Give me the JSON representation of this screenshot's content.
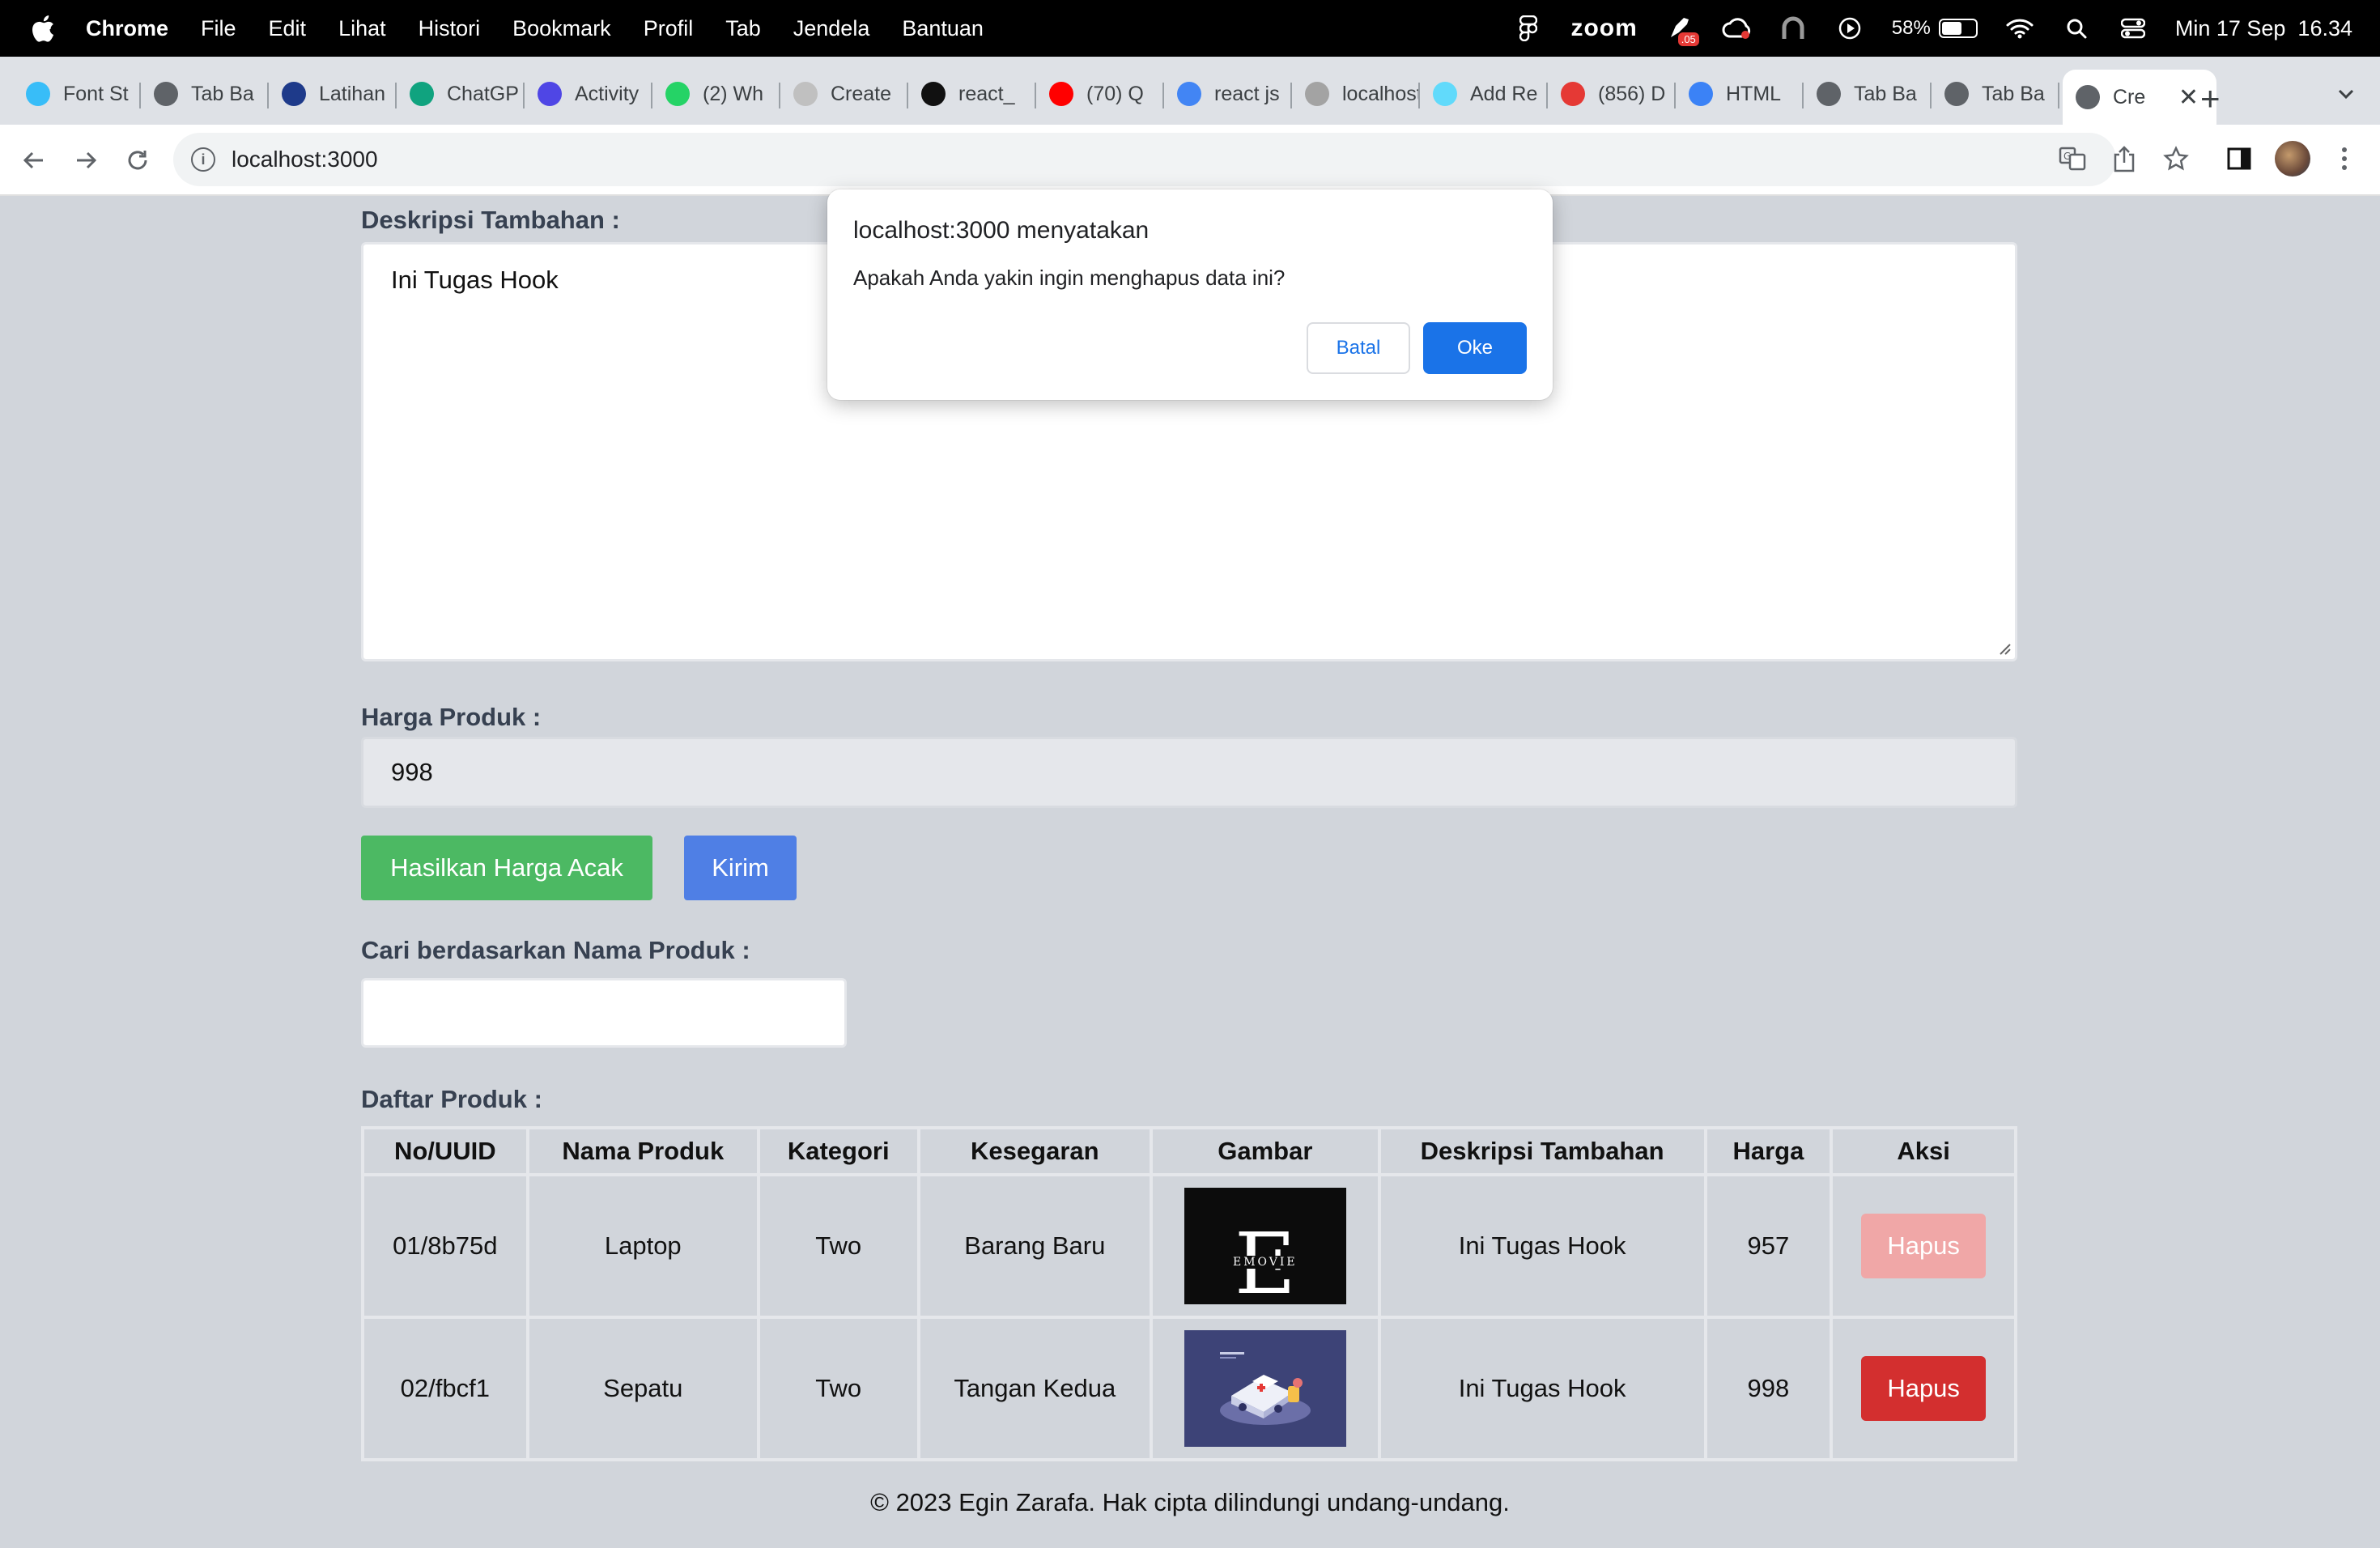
{
  "menubar": {
    "app": "Chrome",
    "items": [
      "File",
      "Edit",
      "Lihat",
      "Histori",
      "Bookmark",
      "Profil",
      "Tab",
      "Jendela",
      "Bantuan"
    ],
    "zoom": "zoom",
    "badge": ".05",
    "battery": "58%",
    "clock": "Min 17 Sep  16.34"
  },
  "tabs": [
    {
      "label": "Font St",
      "icon": "tailwind-icon",
      "color": "#38bdf8"
    },
    {
      "label": "Tab Ba",
      "icon": "chrome-icon",
      "color": "#5f6368"
    },
    {
      "label": "Latihan",
      "icon": "one-logo-icon",
      "color": "#1e3a8a"
    },
    {
      "label": "ChatGP",
      "icon": "openai-icon",
      "color": "#10a37f"
    },
    {
      "label": "Activity",
      "icon": "activity-icon",
      "color": "#4f46e5"
    },
    {
      "label": "(2) Wh",
      "icon": "whatsapp-icon",
      "color": "#25d366"
    },
    {
      "label": "Create",
      "icon": "loading-icon",
      "color": "#c0c0c0"
    },
    {
      "label": "react_",
      "icon": "github-icon",
      "color": "#111111"
    },
    {
      "label": "(70) Q",
      "icon": "youtube-icon",
      "color": "#ff0000"
    },
    {
      "label": "react js",
      "icon": "google-icon",
      "color": "#4285f4"
    },
    {
      "label": "localhost",
      "icon": "vite-icon",
      "color": "#a3a3a3"
    },
    {
      "label": "Add Re",
      "icon": "react-icon",
      "color": "#61dafb"
    },
    {
      "label": "(856) D",
      "icon": "notification-icon",
      "color": "#e53935"
    },
    {
      "label": "HTML",
      "icon": "html-icon",
      "color": "#3b82f6"
    },
    {
      "label": "Tab Ba",
      "icon": "chrome-icon",
      "color": "#5f6368"
    },
    {
      "label": "Tab Ba",
      "icon": "chrome-icon",
      "color": "#5f6368"
    }
  ],
  "active_tab": {
    "label": "Cre",
    "icon": "globe-icon"
  },
  "address": {
    "url": "localhost:3000"
  },
  "form": {
    "desc_label": "Deskripsi Tambahan :",
    "desc_value": "Ini Tugas Hook",
    "price_label": "Harga Produk :",
    "price_value": "998",
    "random_btn": "Hasilkan Harga Acak",
    "submit_btn": "Kirim",
    "search_label": "Cari berdasarkan Nama Produk :",
    "search_value": ""
  },
  "list": {
    "title": "Daftar Produk :",
    "headers": [
      "No/UUID",
      "Nama Produk",
      "Kategori",
      "Kesegaran",
      "Gambar",
      "Deskripsi Tambahan",
      "Harga",
      "Aksi"
    ],
    "rows": [
      {
        "id": "01/8b75d",
        "name": "Laptop",
        "category": "Two",
        "freshness": "Barang Baru",
        "image": "emovie",
        "image_big": "E",
        "image_small": "EMOVIE",
        "desc": "Ini Tugas Hook",
        "price": "957",
        "action": "Hapus"
      },
      {
        "id": "02/fbcf1",
        "name": "Sepatu",
        "category": "Two",
        "freshness": "Tangan Kedua",
        "image": "ambulance",
        "desc": "Ini Tugas Hook",
        "price": "998",
        "action": "Hapus"
      }
    ]
  },
  "footer": "© 2023 Egin Zarafa. Hak cipta dilindungi undang-undang.",
  "dialog": {
    "title": "localhost:3000 menyatakan",
    "message": "Apakah Anda yakin ingin menghapus data ini?",
    "cancel": "Batal",
    "ok": "Oke"
  }
}
